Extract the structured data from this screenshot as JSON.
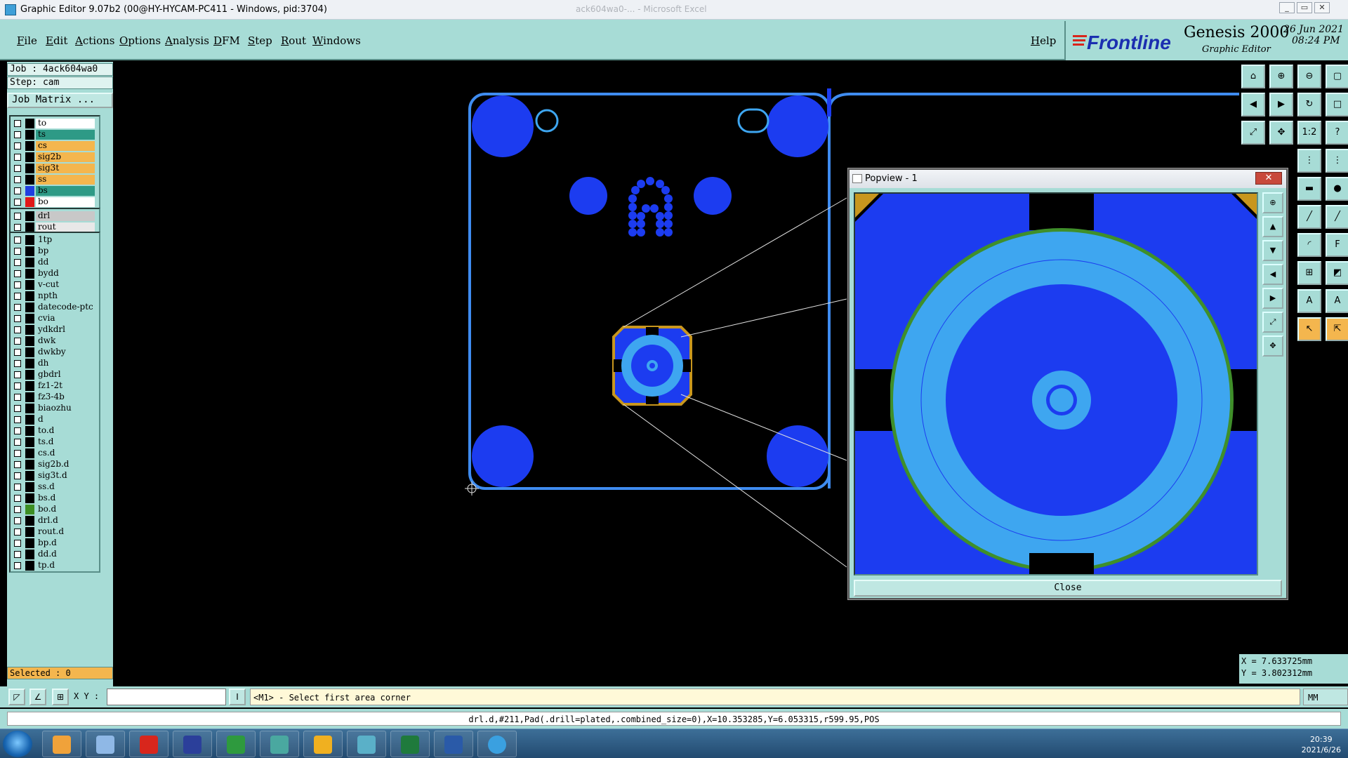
{
  "window": {
    "title": "Graphic Editor 9.07b2 (00@HY-HYCAM-PC411 - Windows, pid:3704)",
    "background_title": "ack604wa0-... - Microsoft Excel",
    "controls": {
      "minimize": "_",
      "restore": "▭",
      "close": "✕"
    }
  },
  "menubar": {
    "items": [
      "File",
      "Edit",
      "Actions",
      "Options",
      "Analysis",
      "DFM",
      "Step",
      "Rout",
      "Windows"
    ],
    "help": "Help",
    "brand": "Frontline",
    "product": "Genesis 2000",
    "subtitle": "Graphic Editor",
    "date": "26 Jun 2021",
    "time": "08:24 PM"
  },
  "left_panel": {
    "job": "Job : 4ack604wa0",
    "step": "Step: cam",
    "job_matrix": "Job Matrix ...",
    "selected": "Selected : 0",
    "groups": [
      [
        {
          "name": "to",
          "color": "#ffffff",
          "swatch": "#000000"
        },
        {
          "name": "ts",
          "color": "#2e9a86",
          "swatch": "#000000"
        },
        {
          "name": "cs",
          "color": "#f4b64e",
          "swatch": "#000000"
        },
        {
          "name": "sig2b",
          "color": "#f4b64e",
          "swatch": "#000000"
        },
        {
          "name": "sig3t",
          "color": "#f4b64e",
          "swatch": "#000000"
        },
        {
          "name": "ss",
          "color": "#f4b64e",
          "swatch": "#000000"
        },
        {
          "name": "bs",
          "color": "#2e9a86",
          "swatch": "#1f3fe0"
        },
        {
          "name": "bo",
          "color": "#ffffff",
          "swatch": "#e01818"
        }
      ],
      [
        {
          "name": "drl",
          "color": "#c8c8c8",
          "swatch": "#000000"
        },
        {
          "name": "rout",
          "color": "#e8e8e8",
          "swatch": "#000000"
        }
      ],
      [
        {
          "name": "1tp",
          "color": "#a7dcd6",
          "swatch": "#000000"
        },
        {
          "name": "bp",
          "color": "#a7dcd6",
          "swatch": "#000000"
        },
        {
          "name": "dd",
          "color": "#a7dcd6",
          "swatch": "#000000"
        },
        {
          "name": "bydd",
          "color": "#a7dcd6",
          "swatch": "#000000"
        },
        {
          "name": "v-cut",
          "color": "#a7dcd6",
          "swatch": "#000000"
        },
        {
          "name": "npth",
          "color": "#a7dcd6",
          "swatch": "#000000"
        },
        {
          "name": "datecode-ptc",
          "color": "#a7dcd6",
          "swatch": "#000000"
        },
        {
          "name": "cvia",
          "color": "#a7dcd6",
          "swatch": "#000000"
        },
        {
          "name": "ydkdrl",
          "color": "#a7dcd6",
          "swatch": "#000000"
        },
        {
          "name": "dwk",
          "color": "#a7dcd6",
          "swatch": "#000000"
        },
        {
          "name": "dwkby",
          "color": "#a7dcd6",
          "swatch": "#000000"
        },
        {
          "name": "dh",
          "color": "#a7dcd6",
          "swatch": "#000000"
        },
        {
          "name": "gbdrl",
          "color": "#a7dcd6",
          "swatch": "#000000"
        },
        {
          "name": "fz1-2t",
          "color": "#a7dcd6",
          "swatch": "#000000"
        },
        {
          "name": "fz3-4b",
          "color": "#a7dcd6",
          "swatch": "#000000"
        },
        {
          "name": "biaozhu",
          "color": "#a7dcd6",
          "swatch": "#000000"
        },
        {
          "name": "d",
          "color": "#a7dcd6",
          "swatch": "#000000"
        },
        {
          "name": "to.d",
          "color": "#a7dcd6",
          "swatch": "#000000"
        },
        {
          "name": "ts.d",
          "color": "#a7dcd6",
          "swatch": "#000000"
        },
        {
          "name": "cs.d",
          "color": "#a7dcd6",
          "swatch": "#000000"
        },
        {
          "name": "sig2b.d",
          "color": "#a7dcd6",
          "swatch": "#000000"
        },
        {
          "name": "sig3t.d",
          "color": "#a7dcd6",
          "swatch": "#000000"
        },
        {
          "name": "ss.d",
          "color": "#a7dcd6",
          "swatch": "#000000"
        },
        {
          "name": "bs.d",
          "color": "#a7dcd6",
          "swatch": "#000000"
        },
        {
          "name": "bo.d",
          "color": "#a7dcd6",
          "swatch": "#3d8f24"
        },
        {
          "name": "drl.d",
          "color": "#a7dcd6",
          "swatch": "#000000"
        },
        {
          "name": "rout.d",
          "color": "#a7dcd6",
          "swatch": "#000000"
        },
        {
          "name": "bp.d",
          "color": "#a7dcd6",
          "swatch": "#000000"
        },
        {
          "name": "dd.d",
          "color": "#a7dcd6",
          "swatch": "#000000"
        },
        {
          "name": "tp.d",
          "color": "#a7dcd6",
          "swatch": "#000000"
        }
      ]
    ]
  },
  "popview": {
    "title": "Popview - 1",
    "close_label": "Close"
  },
  "coords": {
    "x": "X = 7.633725mm",
    "y": "Y = 3.802312mm"
  },
  "input_bar": {
    "xy_label": "X Y :",
    "prompt": "<M1> - Select first area corner",
    "units": "MM"
  },
  "status": "drl.d,#211,Pad(.drill=plated,.combined_size=0),X=10.353285,Y=6.053315,r599.95,POS",
  "taskbar": {
    "time": "20:39",
    "date": "2021/6/26"
  },
  "colors": {
    "accent_panel": "#a7dcd6",
    "copper_blue": "#1c3cf0",
    "light_blue": "#3ea6f0",
    "outline": "#3f8cf0",
    "gold": "#c8961e",
    "green": "#3d8f24"
  }
}
